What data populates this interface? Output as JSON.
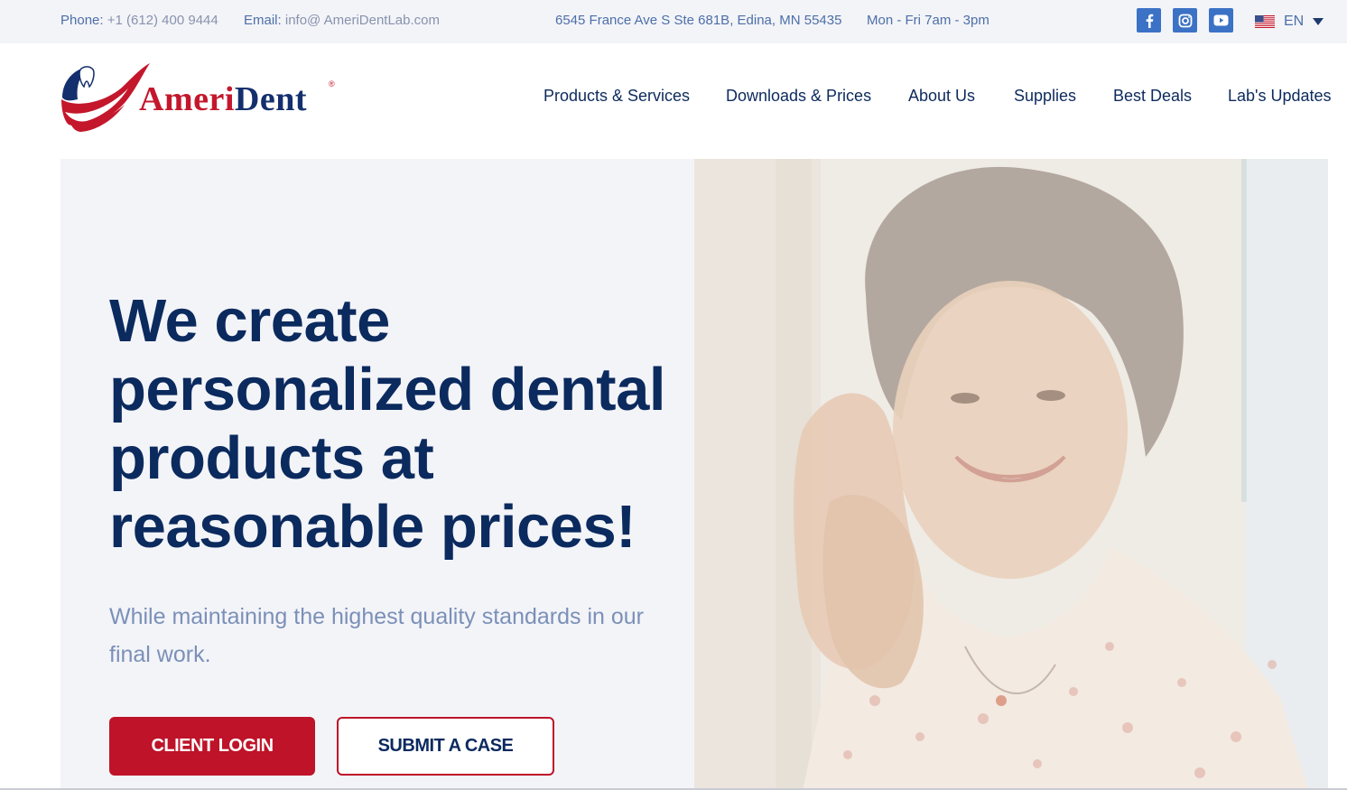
{
  "topbar": {
    "phone_label": "Phone:",
    "phone_value": "+1 (612) 400 9444",
    "email_label": "Email:",
    "email_value": "info@ AmeriDentLab.com",
    "address": "6545 France Ave S Ste 681B, Edina, MN 55435",
    "hours": "Mon - Fri 7am - 3pm",
    "social": [
      {
        "icon": "facebook-icon"
      },
      {
        "icon": "instagram-icon"
      },
      {
        "icon": "youtube-icon"
      }
    ],
    "language": "EN"
  },
  "header": {
    "logo_text_part1": "Ameri",
    "logo_text_part2": "Dent",
    "logo_mark": "®",
    "nav": [
      {
        "label": "Products & Services"
      },
      {
        "label": "Downloads & Prices"
      },
      {
        "label": "About Us"
      },
      {
        "label": "Supplies"
      },
      {
        "label": "Best Deals"
      },
      {
        "label": "Lab's Updates"
      }
    ]
  },
  "hero": {
    "title": "We create personalized dental products at reasonable prices!",
    "subtitle": "While maintaining the highest quality standards in our final work.",
    "primary_button": "CLIENT LOGIN",
    "secondary_button": "SUBMIT A CASE"
  },
  "colors": {
    "brand_red": "#be1328",
    "brand_navy": "#0b2a5e",
    "social_blue": "#3b72c6",
    "hero_bg": "#f3f4f8",
    "topbar_bg": "#f3f4f8"
  }
}
